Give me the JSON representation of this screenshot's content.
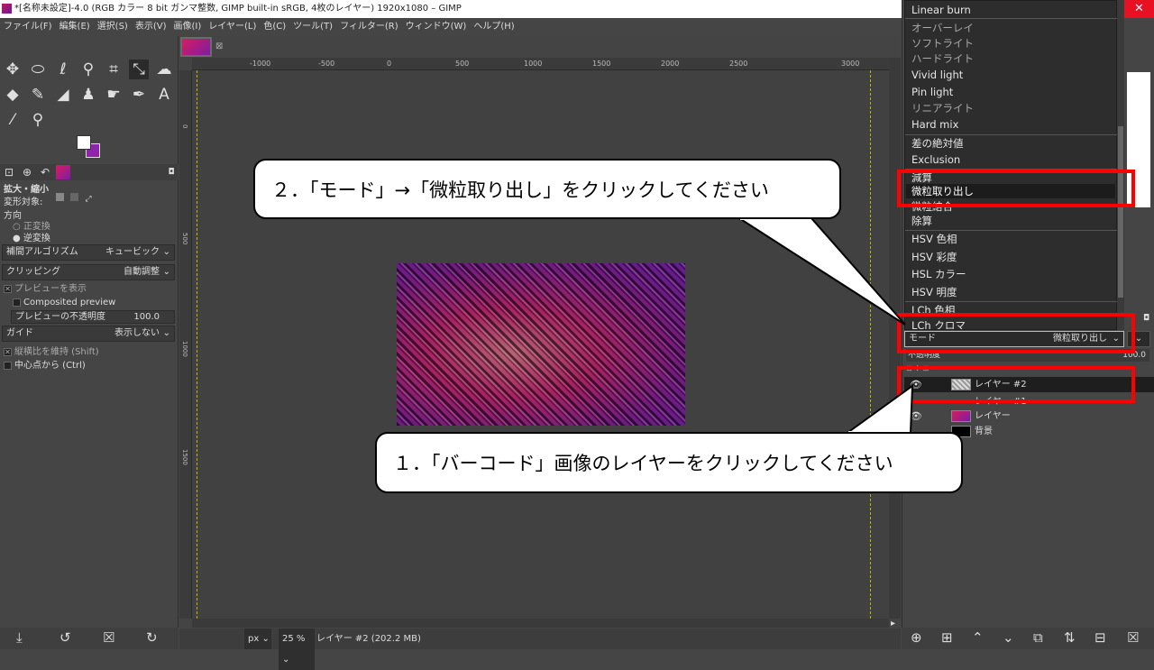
{
  "window": {
    "title": "*[名称未設定]-4.0 (RGB カラー 8 bit ガンマ整数, GIMP built-in sRGB, 4枚のレイヤー) 1920x1080 – GIMP",
    "close_symbol": "✕"
  },
  "menubar": [
    "ファイル(F)",
    "編集(E)",
    "選択(S)",
    "表示(V)",
    "画像(I)",
    "レイヤー(L)",
    "色(C)",
    "ツール(T)",
    "フィルター(R)",
    "ウィンドウ(W)",
    "ヘルプ(H)"
  ],
  "toolbox": {
    "tab_title": "拡大・縮小",
    "transform_label": "変形対象:",
    "direction_label": "方向",
    "direction_options": [
      "正変換",
      "逆変換"
    ],
    "interpolation": {
      "label": "補間アルゴリズム",
      "value": "キュービック"
    },
    "clipping": {
      "label": "クリッピング",
      "value": "自動調整"
    },
    "show_preview": "プレビューを表示",
    "composited_preview": "Composited preview",
    "preview_opacity": {
      "label": "プレビューの不透明度",
      "value": "100.0"
    },
    "guides": {
      "label": "ガイド",
      "value": "表示しない"
    },
    "keep_aspect": "縦横比を維持 (Shift)",
    "from_center": "中心点から (Ctrl)"
  },
  "canvas": {
    "ruler_ticks": [
      "-1000",
      "-500",
      "0",
      "500",
      "1000",
      "1500",
      "2000",
      "2500",
      "3000"
    ],
    "vruler_ticks": [
      "0",
      "500",
      "1000",
      "1500"
    ]
  },
  "statusbar": {
    "unit": "px",
    "zoom": "25 %",
    "info": "レイヤー #2 (202.2 MB)"
  },
  "mode_menu": {
    "items": [
      "Linear burn",
      "オーバーレイ",
      "ソフトライト",
      "ハードライト",
      "Vivid light",
      "Pin light",
      "リニアライト",
      "Hard mix",
      "差の絶対値",
      "Exclusion",
      "減算",
      "微粒取り出し",
      "微粒結合",
      "除算",
      "HSV 色相",
      "HSV 彩度",
      "HSL カラー",
      "HSV 明度",
      "LCh 色相",
      "LCh クロマ"
    ],
    "selected": "微粒取り出し"
  },
  "layers_panel": {
    "mode_label": "モード",
    "mode_value": "微粒取り出し",
    "opacity_label": "不透明度",
    "opacity_value": "100.0",
    "layers": [
      {
        "name": "レイヤー #2",
        "selected": true
      },
      {
        "name": "レイヤー #1",
        "selected": false
      },
      {
        "name": "レイヤー",
        "selected": false
      },
      {
        "name": "背景",
        "selected": false
      }
    ]
  },
  "callouts": {
    "step1": "１．「バーコード」画像のレイヤーをクリックしてください",
    "step2": "２．「モード」→「微粒取り出し」をクリックしてください"
  },
  "colors": {
    "highlight": "#ff0000",
    "accent_purple": "#8e24aa"
  }
}
